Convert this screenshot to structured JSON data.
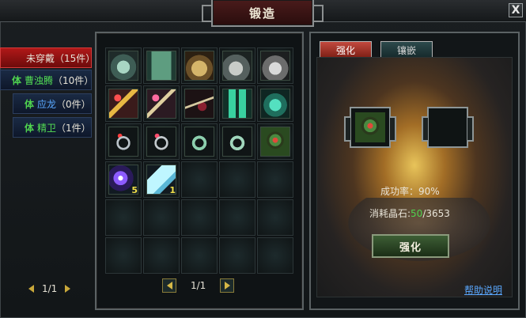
{
  "window": {
    "title": "锻造",
    "close_label": "X"
  },
  "categories": [
    {
      "icon": "",
      "label": "未穿戴",
      "count": "（15件）",
      "active": true
    },
    {
      "icon": "体",
      "label": "曹浊腾",
      "count": "（10件）",
      "active": false
    },
    {
      "icon": "体",
      "label": "应龙",
      "count": "（0件）",
      "active": false
    },
    {
      "icon": "体",
      "label": "精卫",
      "count": "（1件）",
      "active": false
    }
  ],
  "left_pager": {
    "text": "1/1"
  },
  "inventory": {
    "items": [
      {
        "icon": "armor-icon",
        "qty": ""
      },
      {
        "icon": "belt-icon",
        "qty": ""
      },
      {
        "icon": "helmet-icon",
        "qty": ""
      },
      {
        "icon": "boots-icon",
        "qty": ""
      },
      {
        "icon": "greaves-icon",
        "qty": ""
      },
      {
        "icon": "staff-red-icon",
        "qty": ""
      },
      {
        "icon": "staff-pink-icon",
        "qty": ""
      },
      {
        "icon": "bow-icon",
        "qty": ""
      },
      {
        "icon": "pants-icon",
        "qty": ""
      },
      {
        "icon": "glove-icon",
        "qty": ""
      },
      {
        "icon": "ring-red-icon",
        "qty": ""
      },
      {
        "icon": "ring-pink-icon",
        "qty": ""
      },
      {
        "icon": "ring-jade-icon",
        "qty": ""
      },
      {
        "icon": "ring-jade2-icon",
        "qty": ""
      },
      {
        "icon": "ring-green-icon",
        "qty": ""
      },
      {
        "icon": "gem-icon",
        "qty": "5"
      },
      {
        "icon": "crystal-icon",
        "qty": "1"
      }
    ],
    "total_slots": 30,
    "pager": {
      "text": "1/1"
    }
  },
  "tabs": {
    "strengthen": "强化",
    "inlay": "镶嵌"
  },
  "forge": {
    "target_item_icon": "ring-green-icon",
    "success_label": "成功率：",
    "success_value": "90%",
    "consume_label": "消耗晶石:",
    "consume_have": "50",
    "consume_total": "/3653",
    "button_label": "强化",
    "help_link": "帮助说明"
  }
}
